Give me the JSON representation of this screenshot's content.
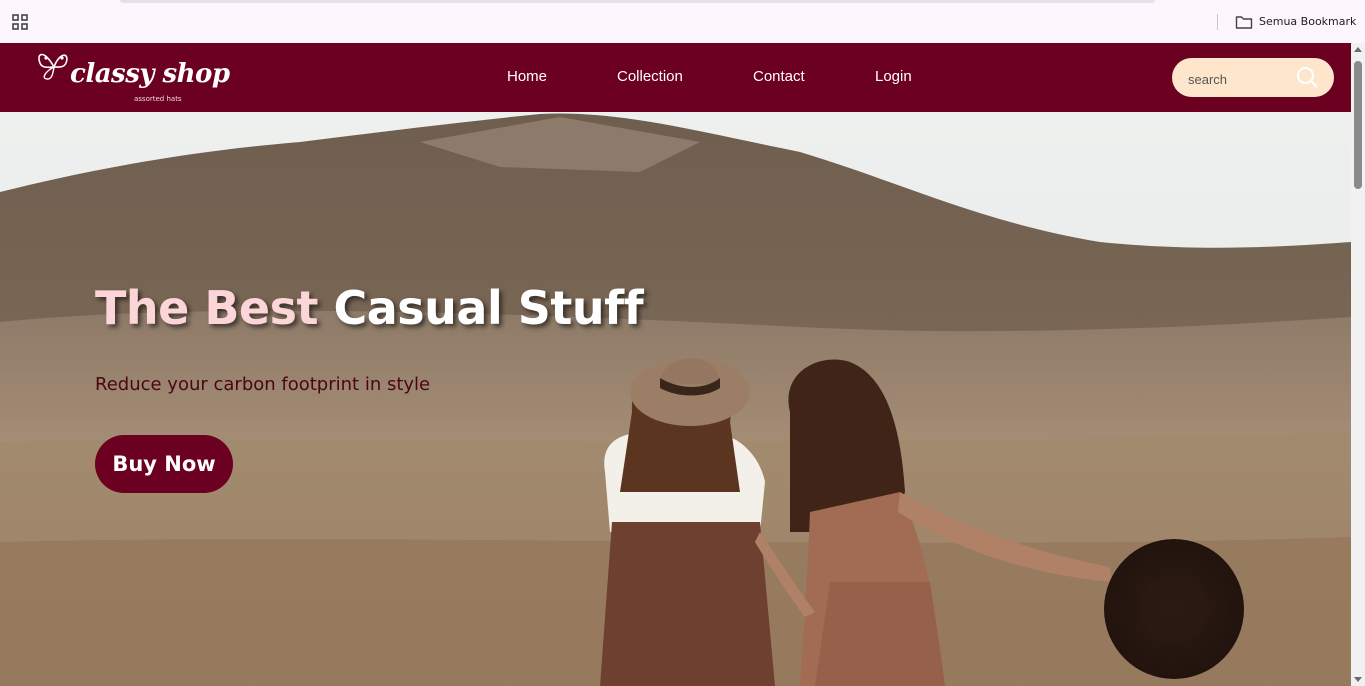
{
  "bookmarks_bar": {
    "apps_icon": "apps-grid-icon",
    "folder_icon": "folder-icon",
    "all_bookmarks_label": "Semua Bookmark"
  },
  "header": {
    "logo_text": "classy shop",
    "logo_sub": "assorted hats",
    "nav": [
      {
        "label": "Home"
      },
      {
        "label": "Collection"
      },
      {
        "label": "Contact"
      },
      {
        "label": "Login"
      }
    ],
    "search": {
      "placeholder": "search",
      "icon": "search-icon"
    }
  },
  "hero": {
    "title_accent": "The Best",
    "title_rest": "Casual Stuff",
    "subtitle": "Reduce your carbon footprint in style",
    "cta_label": "Buy Now"
  },
  "colors": {
    "brand": "#6b0020",
    "search_bg": "#fde6cc",
    "title_accent": "#fcd5d8"
  }
}
